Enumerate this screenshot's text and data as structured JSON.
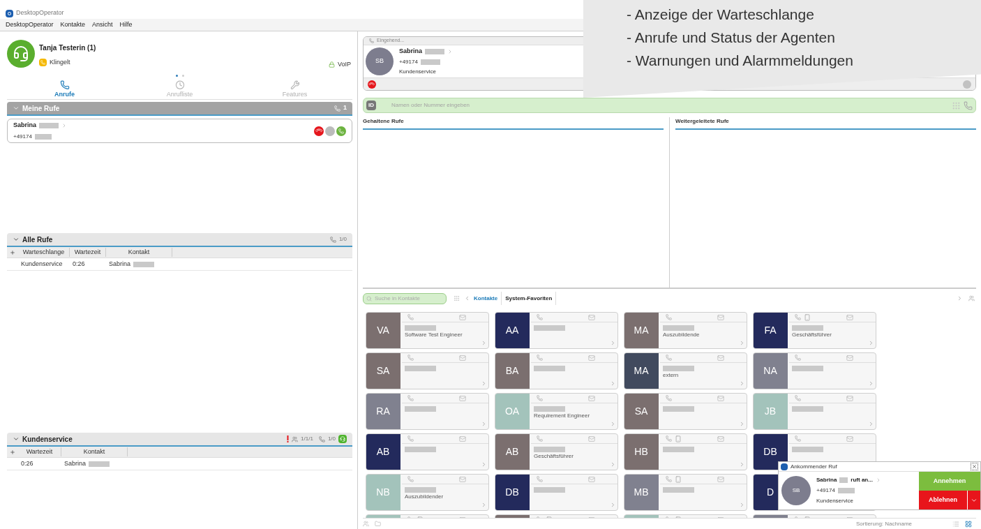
{
  "window": {
    "title": "DesktopOperator"
  },
  "menu": [
    "DesktopOperator",
    "Kontakte",
    "Ansicht",
    "Hilfe"
  ],
  "callout": {
    "lines": [
      "- Anzeige der Warteschlange",
      "- Anrufe und Status der Agenten",
      "- Warnungen und Alarmmeldungen"
    ]
  },
  "agent": {
    "name": "Tanja Testerin (1)",
    "status": "Klingelt",
    "line": "VoIP",
    "pages": [
      {
        "selected": true
      },
      {
        "selected": false
      }
    ]
  },
  "nav_tabs": [
    {
      "label": "Anrufe",
      "selected": true,
      "kind": "calls"
    },
    {
      "label": "Anrufliste",
      "selected": false,
      "kind": "history"
    },
    {
      "label": "Features",
      "selected": false,
      "kind": "features"
    }
  ],
  "my_calls": {
    "title": "Meine Rufe",
    "count": "1",
    "calls": [
      {
        "name": "Sabrina",
        "number": "+49174"
      }
    ]
  },
  "all_calls": {
    "title": "Alle Rufe",
    "count": "1/0",
    "columns": [
      "Warteschlange",
      "Wartezeit",
      "Kontakt"
    ],
    "rows": [
      [
        "Kundenservice",
        "0:26",
        "Sabrina"
      ]
    ]
  },
  "queue": {
    "title": "Kundenservice",
    "warning": true,
    "agents": "1/1/1",
    "count": "1/0",
    "columns": [
      "Wartezeit",
      "Kontakt"
    ],
    "rows": [
      [
        "0:26",
        "Sabrina"
      ]
    ]
  },
  "incoming": {
    "state": "Eingehend...",
    "initials": "SB",
    "name": "Sabrina",
    "number": "+49174",
    "queue": "Kundenservice"
  },
  "dial": {
    "badge": "ID",
    "placeholder": "Namen oder Nummer eingeben"
  },
  "held": {
    "title": "Gehaltene Rufe"
  },
  "forwarded": {
    "title": "Weitergeleitete Rufe"
  },
  "contacts": {
    "search_placeholder": "Suche in Kontakte",
    "tabs": [
      {
        "label": "Kontakte",
        "selected": true
      },
      {
        "label": "System-Favoriten",
        "selected": false
      }
    ],
    "cards": [
      {
        "initials": "VA",
        "color": "#7b6f6f",
        "title": "Software Test Engineer",
        "mobile": false
      },
      {
        "initials": "AA",
        "color": "#232a5c",
        "mobile": false
      },
      {
        "initials": "MA",
        "color": "#7b6f6f",
        "title": "Auszubildende",
        "mobile": false
      },
      {
        "initials": "FA",
        "color": "#232a5c",
        "title": "Geschäftsführer",
        "mobile": true
      },
      {
        "initials": "SA",
        "color": "#7b6f6f",
        "mobile": false
      },
      {
        "initials": "BA",
        "color": "#7b6f6f",
        "mobile": false
      },
      {
        "initials": "MA",
        "color": "#414a5e",
        "title": "extern",
        "mobile": false
      },
      {
        "initials": "NA",
        "color": "#80818f",
        "mobile": false
      },
      {
        "initials": "RA",
        "color": "#80818f",
        "mobile": false
      },
      {
        "initials": "OA",
        "color": "#a3c3bb",
        "title": "Requirement Engineer",
        "mobile": false
      },
      {
        "initials": "SA",
        "color": "#7b6f6f",
        "mobile": false
      },
      {
        "initials": "JB",
        "color": "#a3c3bb",
        "mobile": false
      },
      {
        "initials": "AB",
        "color": "#232a5c",
        "mobile": false
      },
      {
        "initials": "AB",
        "color": "#7b6f6f",
        "title": "Geschäftsführer",
        "mobile": false
      },
      {
        "initials": "HB",
        "color": "#7b6f6f",
        "mobile": true
      },
      {
        "initials": "DB",
        "color": "#232a5c",
        "mobile": false
      },
      {
        "initials": "NB",
        "color": "#a3c3bb",
        "title": "Auszubildender",
        "mobile": false
      },
      {
        "initials": "DB",
        "color": "#232a5c",
        "mobile": false
      },
      {
        "initials": "MB",
        "color": "#80818f",
        "mobile": true
      },
      {
        "initials": "D",
        "color": "#232a5c",
        "mobile": false
      },
      {
        "color": "#a3c3bb",
        "mobile": true
      },
      {
        "color": "#7b6f6f",
        "mobile": true
      },
      {
        "color": "#a3c3bb",
        "mobile": true
      },
      {
        "color": "#80818f",
        "mobile": true
      }
    ],
    "sort": "Sortierung: Nachname"
  },
  "popup": {
    "title": "Ankommender Ruf",
    "initials": "SB",
    "caller": "Sabrina",
    "suffix": "ruft an...",
    "number": "+49174",
    "queue": "Kundenservice",
    "accept": "Annehmen",
    "decline": "Ablehnen"
  }
}
